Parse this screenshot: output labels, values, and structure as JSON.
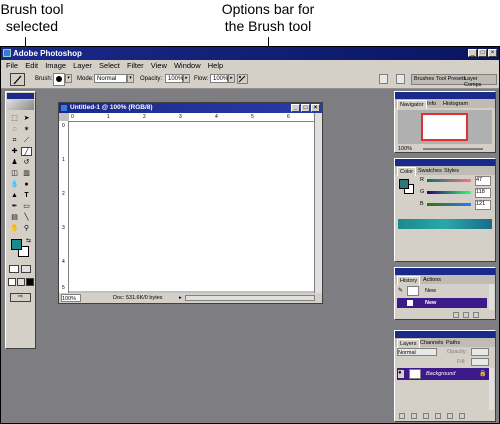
{
  "callouts": {
    "brush_line1": "Brush tool",
    "brush_line2": "selected",
    "options_line1": "Options bar for",
    "options_line2": "the Brush tool"
  },
  "app": {
    "title": "Adobe Photoshop",
    "menu": [
      "File",
      "Edit",
      "Image",
      "Layer",
      "Select",
      "Filter",
      "View",
      "Window",
      "Help"
    ]
  },
  "options_bar": {
    "brush_label": "Brush:",
    "brush_size": "19",
    "mode_label": "Mode:",
    "mode_value": "Normal",
    "opacity_label": "Opacity:",
    "opacity_value": "100%",
    "flow_label": "Flow:",
    "flow_value": "100%",
    "palette_well_tabs": [
      "Brushes",
      "Tool Presets",
      "Layer Comps"
    ]
  },
  "document": {
    "title": "Untitled-1 @ 100% (RGB/8)",
    "zoom": "100%",
    "doc_info": "Doc: 531.6K/0 bytes",
    "ruler_top": [
      "0",
      "1",
      "2",
      "3",
      "4",
      "5",
      "6"
    ],
    "ruler_left": [
      "0",
      "1",
      "2",
      "3",
      "4",
      "5"
    ]
  },
  "navigator_panel": {
    "tabs": [
      "Navigator",
      "Info",
      "Histogram"
    ],
    "zoom": "100%"
  },
  "color_panel": {
    "tabs": [
      "Color",
      "Swatches",
      "Styles"
    ],
    "channels": [
      {
        "label": "R",
        "value": "47"
      },
      {
        "label": "G",
        "value": "118"
      },
      {
        "label": "B",
        "value": "121"
      }
    ],
    "foreground": "#2f7679",
    "background": "#ffffff"
  },
  "history_panel": {
    "tabs": [
      "History",
      "Actions"
    ],
    "items": [
      "New",
      "New"
    ]
  },
  "layers_panel": {
    "tabs": [
      "Layers",
      "Channels",
      "Paths"
    ],
    "blend_mode": "Normal",
    "opacity_label": "Opacity:",
    "fill_label": "Fill:",
    "layer_name": "Background"
  },
  "colors": {
    "titlebar": "#1a2a8a",
    "workspace": "#7e7e82",
    "selected_row": "#3d1a8a",
    "accent_teal": "#1a8a8a"
  }
}
